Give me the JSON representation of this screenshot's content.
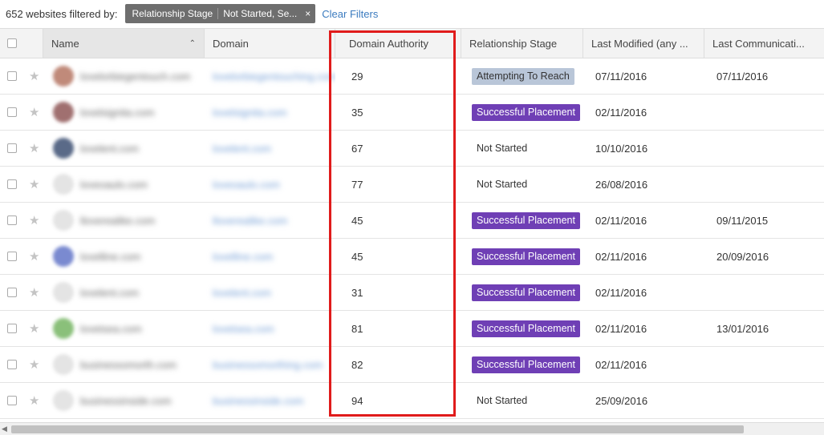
{
  "filter": {
    "count_label": "652 websites filtered by:",
    "chip_field": "Relationship Stage",
    "chip_value": "Not Started, Se...",
    "chip_close": "×",
    "clear_label": "Clear Filters"
  },
  "columns": {
    "name": "Name",
    "domain": "Domain",
    "domain_authority": "Domain Authority",
    "relationship_stage": "Relationship Stage",
    "last_modified": "Last Modified (any ...",
    "last_communication": "Last Communicati..."
  },
  "sort_icon": "chevron-up-icon",
  "rows": [
    {
      "name": "lovelorbiegentouch.com",
      "domain": "lovelorbiegentouching.com",
      "da": "29",
      "stage": "Attempting To Reach",
      "stage_style": "gray",
      "modified": "07/11/2016",
      "comm": "07/11/2016",
      "avatar": "#c08a7a"
    },
    {
      "name": "lovelsignita.com",
      "domain": "lovelsignita.com",
      "da": "35",
      "stage": "Successful Placement",
      "stage_style": "purple",
      "modified": "02/11/2016",
      "comm": "",
      "avatar": "#a07070"
    },
    {
      "name": "lovelent.com",
      "domain": "lovelent.com",
      "da": "67",
      "stage": "Not Started",
      "stage_style": "plain",
      "modified": "10/10/2016",
      "comm": "",
      "avatar": "#5a6a88"
    },
    {
      "name": "loveoaulo.com",
      "domain": "loveoaulo.com",
      "da": "77",
      "stage": "Not Started",
      "stage_style": "plain",
      "modified": "26/08/2016",
      "comm": "",
      "avatar": "#e4e4e4"
    },
    {
      "name": "lloverealike.com",
      "domain": "lloverealike.com",
      "da": "45",
      "stage": "Successful Placement",
      "stage_style": "purple",
      "modified": "02/11/2016",
      "comm": "09/11/2015",
      "avatar": "#e4e4e4"
    },
    {
      "name": "lovelline.com",
      "domain": "lovelline.com",
      "da": "45",
      "stage": "Successful Placement",
      "stage_style": "purple",
      "modified": "02/11/2016",
      "comm": "20/09/2016",
      "avatar": "#7a8ad0"
    },
    {
      "name": "lovelent.com",
      "domain": "lovelent.com",
      "da": "31",
      "stage": "Successful Placement",
      "stage_style": "purple",
      "modified": "02/11/2016",
      "comm": "",
      "avatar": "#e4e4e4"
    },
    {
      "name": "lovetsea.com",
      "domain": "lovetsea.com",
      "da": "81",
      "stage": "Successful Placement",
      "stage_style": "purple",
      "modified": "02/11/2016",
      "comm": "13/01/2016",
      "avatar": "#8ac07a"
    },
    {
      "name": "businessomorth.com",
      "domain": "businessomorthing.com",
      "da": "82",
      "stage": "Successful Placement",
      "stage_style": "purple",
      "modified": "02/11/2016",
      "comm": "",
      "avatar": "#e4e4e4"
    },
    {
      "name": "businessinside.com",
      "domain": "businessinside.com",
      "da": "94",
      "stage": "Not Started",
      "stage_style": "plain",
      "modified": "25/09/2016",
      "comm": "",
      "avatar": "#e4e4e4"
    }
  ],
  "colors": {
    "highlight": "#e01b1b",
    "badge_purple": "#6f3fb5",
    "badge_gray": "#b9c6d8",
    "link": "#3b7bbf"
  }
}
